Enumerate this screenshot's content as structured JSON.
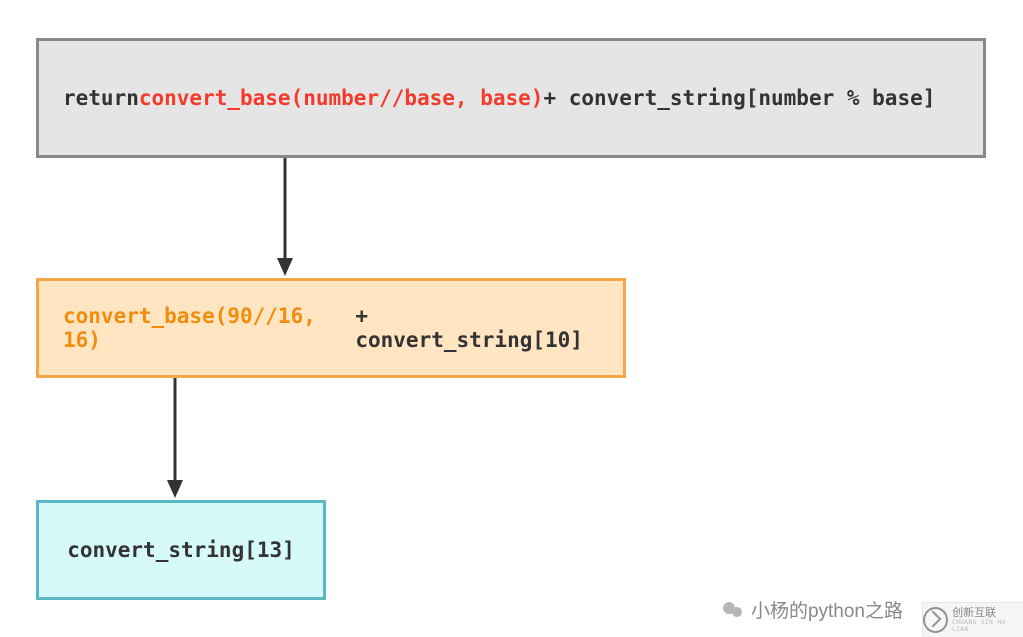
{
  "diagram": {
    "box1": {
      "t1": "return ",
      "t2": "convert_base(number//base, base)",
      "t3": " + convert_string[number % base]"
    },
    "box2": {
      "t1": "convert_base(90//16, 16)",
      "t2": " + convert_string[10]"
    },
    "box3": {
      "t1": "convert_string[13]"
    }
  },
  "watermark": {
    "author": "小杨的python之路",
    "brand": "创新互联",
    "brand_sub": "CHUANG XIN HU LIAN"
  }
}
